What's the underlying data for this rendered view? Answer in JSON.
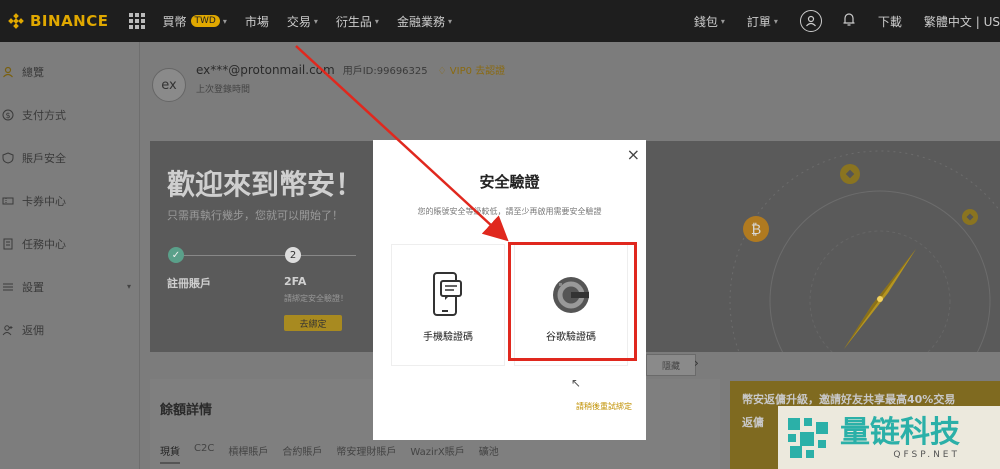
{
  "topnav": {
    "brand": "BINANCE",
    "items": [
      {
        "label": "買幣",
        "badge": "TWD"
      },
      {
        "label": "市場"
      },
      {
        "label": "交易"
      },
      {
        "label": "衍生品"
      },
      {
        "label": "金融業務"
      }
    ],
    "right": {
      "wallet": "錢包",
      "orders": "訂單",
      "download": "下載",
      "language": "繁體中文 | US"
    }
  },
  "sidebar": {
    "items": [
      {
        "label": "總覽"
      },
      {
        "label": "支付方式"
      },
      {
        "label": "賬戶安全"
      },
      {
        "label": "卡券中心"
      },
      {
        "label": "任務中心"
      },
      {
        "label": "設置"
      },
      {
        "label": "返佣"
      }
    ]
  },
  "user": {
    "avatar": "ex",
    "email": "ex***@protonmail.com",
    "uid": "用戶ID:99696325",
    "vip": "VIP0 去認證",
    "last_login": "上次登錄時間"
  },
  "banner": {
    "title": "歡迎來到幣安！",
    "subtitle": "只需再執行幾步，您就可以開始了！",
    "step1_number": "✓",
    "step1_label": "註冊賬戶",
    "step2_number": "2",
    "step2_label": "2FA",
    "step2_desc": "請綁定安全驗證！",
    "step2_button": "去綁定"
  },
  "balance": {
    "title": "餘額詳情",
    "hide": "隱藏",
    "tabs": [
      "現貨",
      "C2C",
      "槓桿賬戶",
      "合約賬戶",
      "幣安理財賬戶",
      "WazirX賬戶",
      "礦池"
    ]
  },
  "promo": {
    "line1": "幣安返傭升級，邀請好友共享最高40%交易",
    "line2": "返傭"
  },
  "modal": {
    "close": "×",
    "title": "安全驗證",
    "description": "您的賬號安全等級較低，請至少再啟用需要安全驗證",
    "option_phone": "手機驗證碼",
    "option_google": "谷歌驗證碼",
    "help": "請稍後重試綁定"
  },
  "watermark": {
    "cn": "量链科技",
    "en": "QFSP.NET"
  },
  "colors": {
    "brand": "#e0a800",
    "highlight": "#e0281e",
    "watermark": "#2bb0a8"
  }
}
